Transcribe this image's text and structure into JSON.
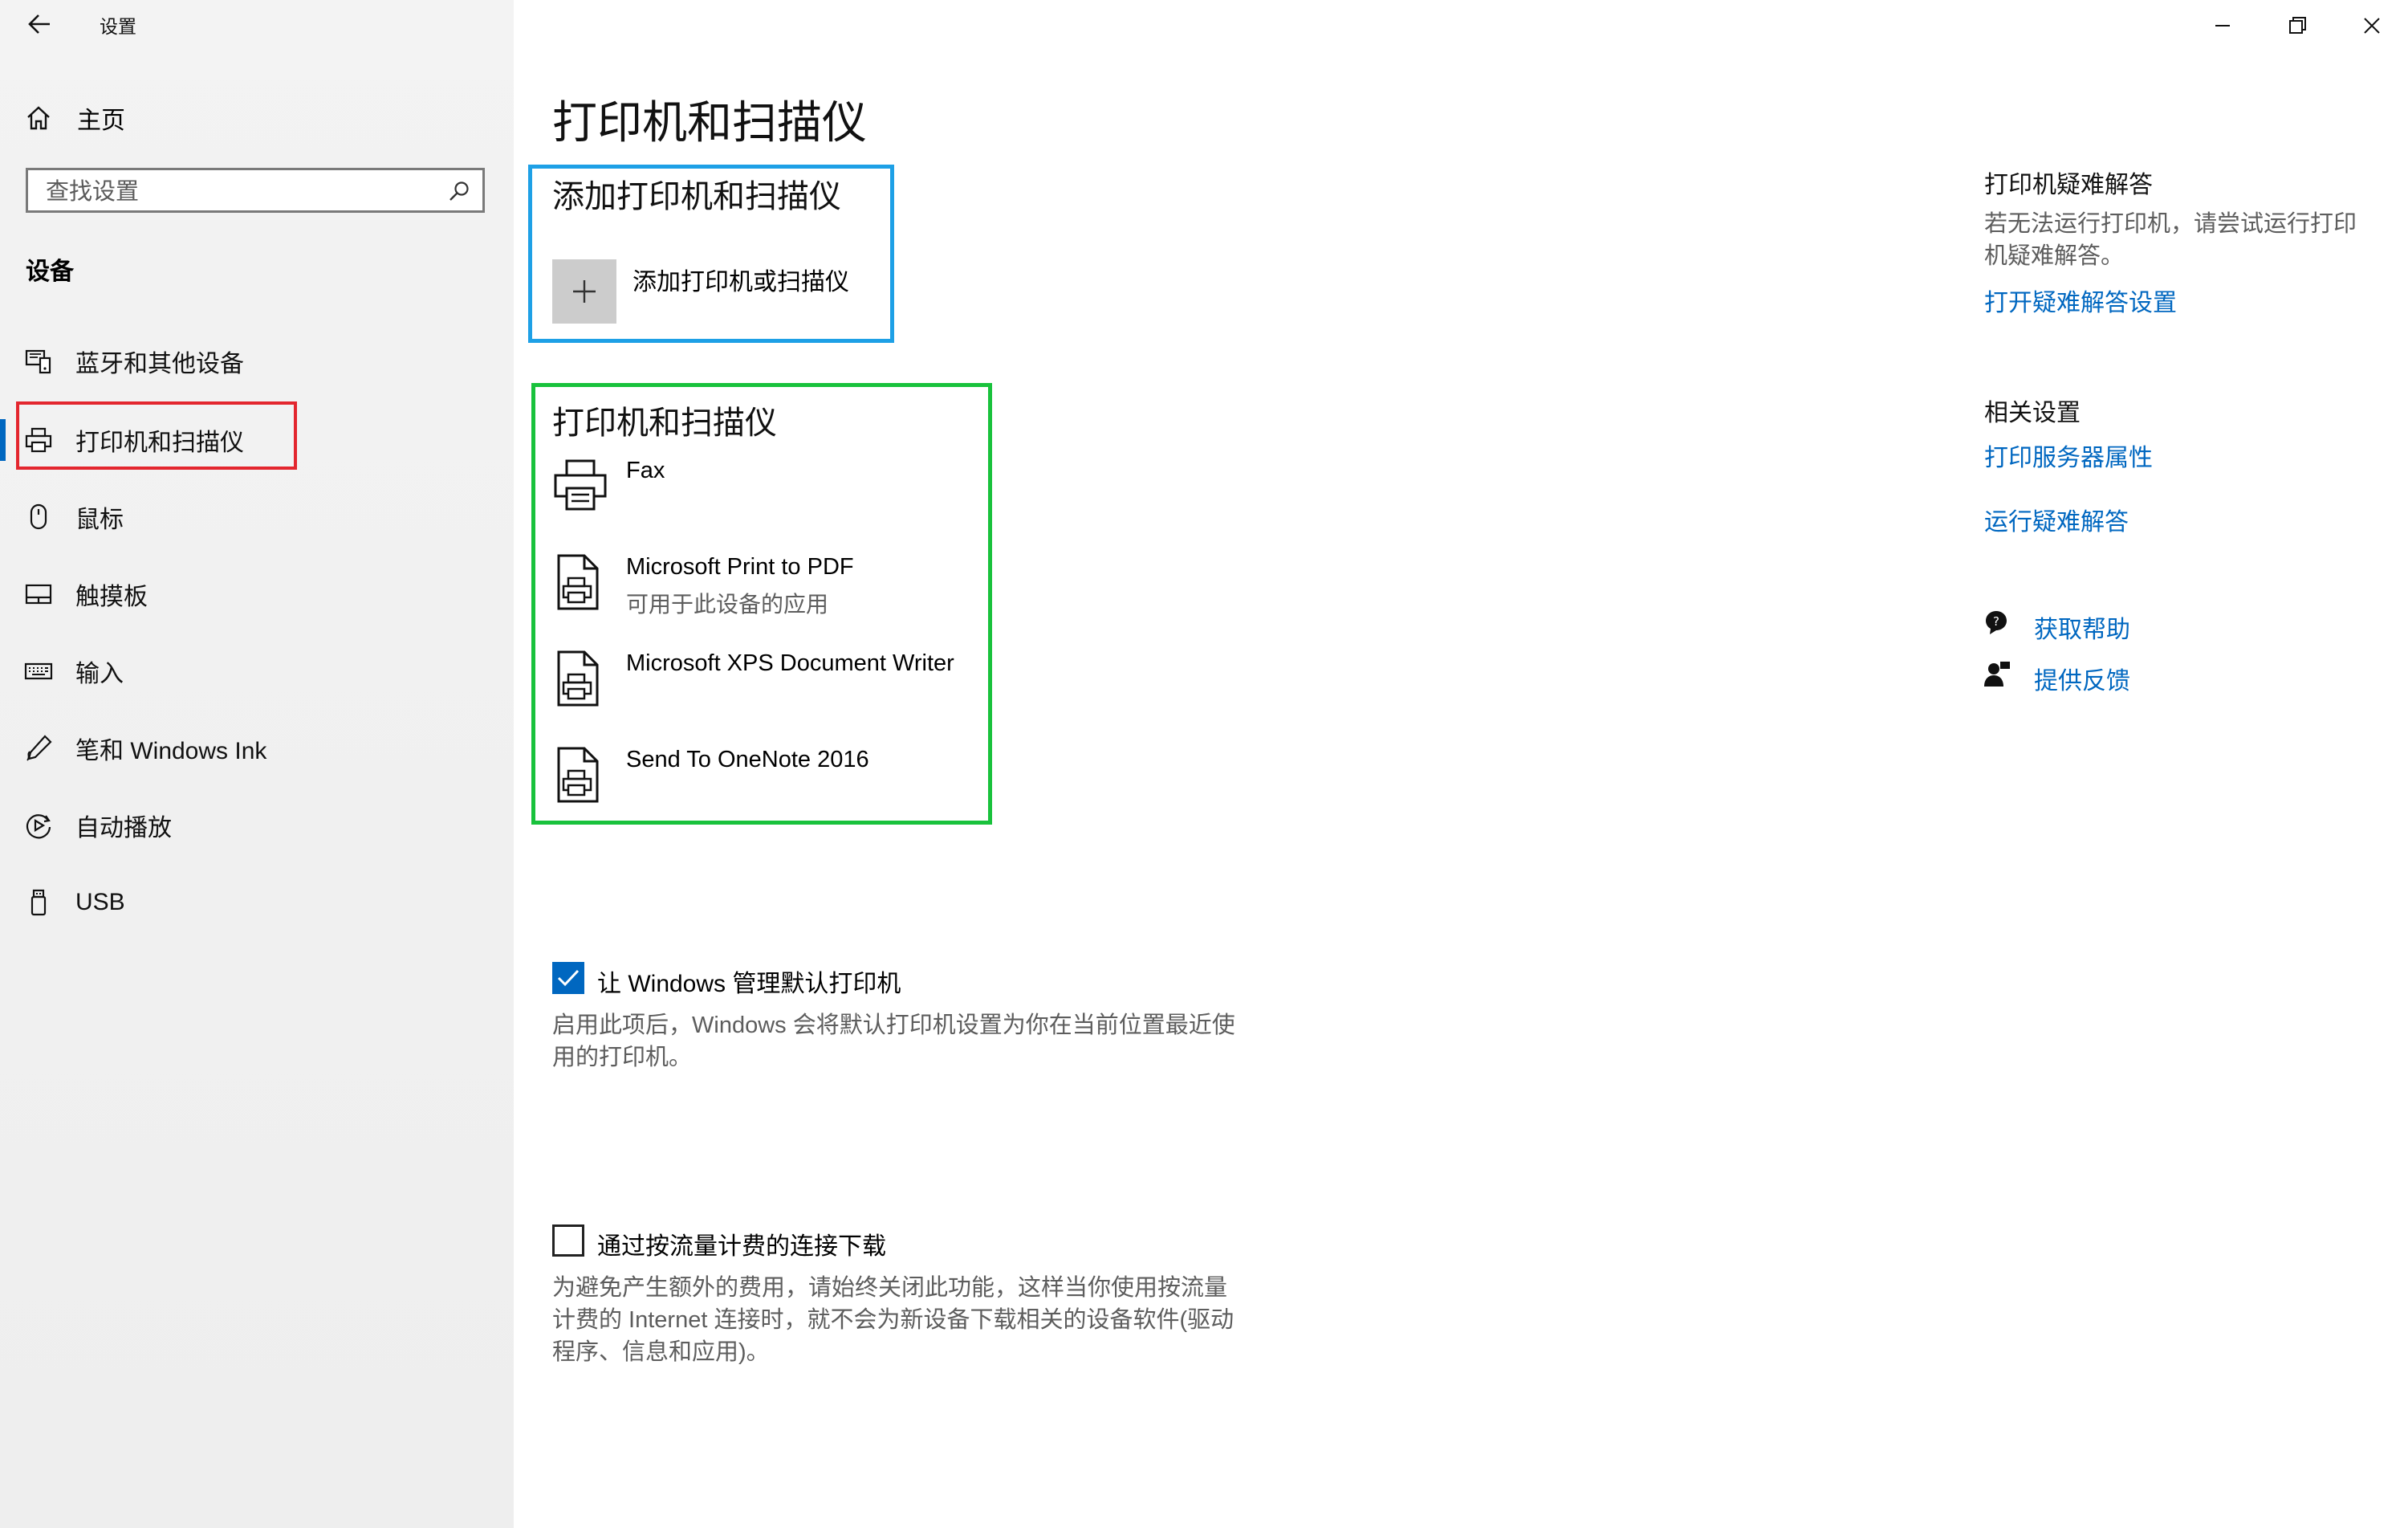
{
  "window": {
    "title": "设置",
    "controls": {
      "minimize": "minimize-icon",
      "restore": "restore-icon",
      "close": "close-icon"
    }
  },
  "sidebar": {
    "home_label": "主页",
    "search_placeholder": "查找设置",
    "section_title": "设备",
    "items": [
      {
        "label": "蓝牙和其他设备",
        "icon": "bluetooth-devices-icon",
        "selected": false
      },
      {
        "label": "打印机和扫描仪",
        "icon": "printer-icon",
        "selected": true
      },
      {
        "label": "鼠标",
        "icon": "mouse-icon",
        "selected": false
      },
      {
        "label": "触摸板",
        "icon": "touchpad-icon",
        "selected": false
      },
      {
        "label": "输入",
        "icon": "keyboard-icon",
        "selected": false
      },
      {
        "label": "笔和 Windows Ink",
        "icon": "pen-icon",
        "selected": false
      },
      {
        "label": "自动播放",
        "icon": "autoplay-icon",
        "selected": false
      },
      {
        "label": "USB",
        "icon": "usb-icon",
        "selected": false
      }
    ]
  },
  "main": {
    "page_title": "打印机和扫描仪",
    "add_section": {
      "heading": "添加打印机和扫描仪",
      "button_label": "添加打印机或扫描仪"
    },
    "devices_section": {
      "heading": "打印机和扫描仪",
      "devices": [
        {
          "name": "Fax",
          "subtitle": "",
          "icon": "fax-printer-icon"
        },
        {
          "name": "Microsoft Print to PDF",
          "subtitle": "可用于此设备的应用",
          "icon": "document-printer-icon"
        },
        {
          "name": "Microsoft XPS Document Writer",
          "subtitle": "",
          "icon": "document-printer-icon"
        },
        {
          "name": "Send To OneNote 2016",
          "subtitle": "",
          "icon": "document-printer-icon"
        }
      ]
    },
    "default_printer": {
      "checked": true,
      "label": "让 Windows 管理默认打印机",
      "desc_line1": "启用此项后，Windows 会将默认打印机设置为你在当前位置最近使",
      "desc_line2": "用的打印机。"
    },
    "metered": {
      "checked": false,
      "label": "通过按流量计费的连接下载",
      "desc_line1": "为避免产生额外的费用，请始终关闭此功能，这样当你使用按流量",
      "desc_line2": "计费的 Internet 连接时，就不会为新设备下载相关的设备软件(驱动",
      "desc_line3": "程序、信息和应用)。"
    }
  },
  "right_pane": {
    "troubleshoot": {
      "heading": "打印机疑难解答",
      "text_line1": "若无法运行打印机，请尝试运行打印",
      "text_line2": "机疑难解答。",
      "link": "打开疑难解答设置"
    },
    "related": {
      "heading": "相关设置",
      "link1": "打印服务器属性",
      "link2": "运行疑难解答"
    },
    "help": {
      "get_help": "获取帮助",
      "feedback": "提供反馈"
    }
  },
  "colors": {
    "accent": "#0067c0",
    "highlight_red": "#e3262e",
    "highlight_blue": "#1ea0e6",
    "highlight_green": "#19c23c"
  }
}
